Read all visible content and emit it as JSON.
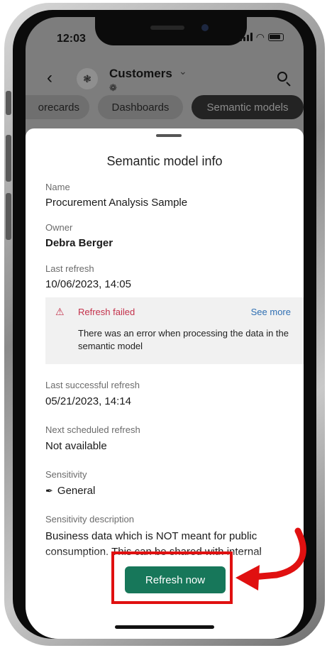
{
  "status_bar": {
    "time": "12:03"
  },
  "header": {
    "title": "Customers",
    "avatar_icon": "workspace-people-icon",
    "subtitle_icon": "shared-icon"
  },
  "tabs": [
    {
      "label": "Scorecards",
      "display": "orecards",
      "active": false
    },
    {
      "label": "Dashboards",
      "active": false
    },
    {
      "label": "Semantic models",
      "active": true
    }
  ],
  "sheet": {
    "title": "Semantic model info",
    "name_label": "Name",
    "name_value": "Procurement Analysis Sample",
    "owner_label": "Owner",
    "owner_value": "Debra Berger",
    "last_refresh_label": "Last refresh",
    "last_refresh_value": "10/06/2023, 14:05",
    "alert": {
      "title": "Refresh failed",
      "link": "See more",
      "body": "There was an error when processing the data in the semantic model"
    },
    "last_success_label": "Last successful refresh",
    "last_success_value": "05/21/2023, 14:14",
    "next_scheduled_label": "Next scheduled refresh",
    "next_scheduled_value": "Not available",
    "sensitivity_label": "Sensitivity",
    "sensitivity_value": "General",
    "sensitivity_desc_label": "Sensitivity description",
    "sensitivity_desc_value": "Business data which is NOT meant for public consumption. This can be shared with internal"
  },
  "actions": {
    "refresh_label": "Refresh now"
  },
  "colors": {
    "primary_button": "#17775a",
    "error": "#c4314b",
    "link": "#2f6fb3",
    "annotation": "#e01010"
  }
}
